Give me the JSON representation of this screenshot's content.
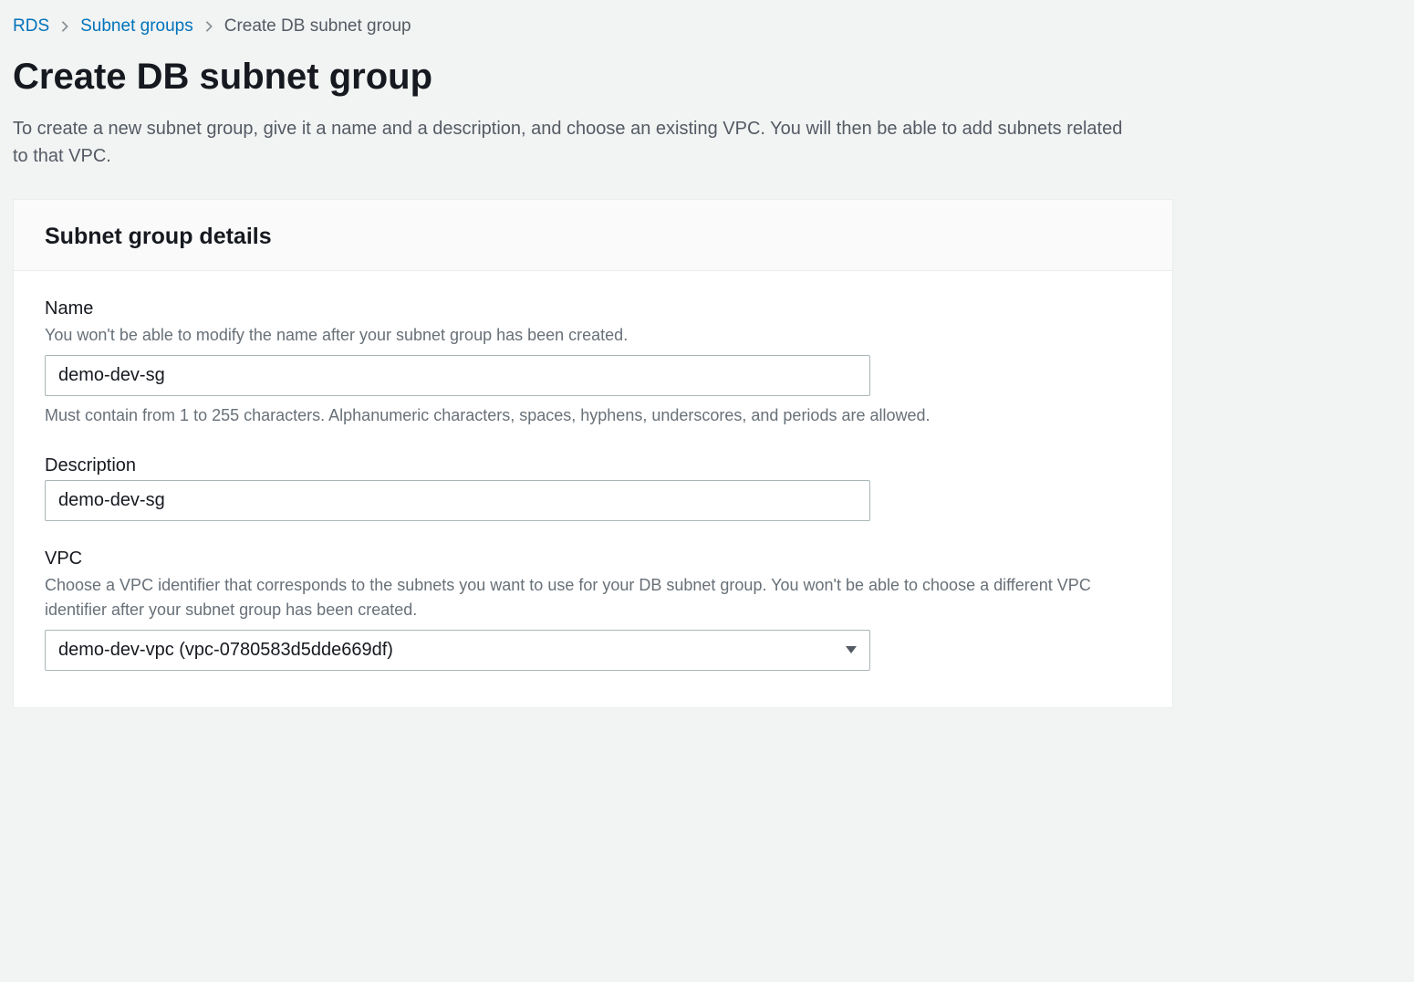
{
  "breadcrumb": {
    "items": [
      {
        "label": "RDS",
        "link": true
      },
      {
        "label": "Subnet groups",
        "link": true
      },
      {
        "label": "Create DB subnet group",
        "link": false
      }
    ]
  },
  "page": {
    "title": "Create DB subnet group",
    "description": "To create a new subnet group, give it a name and a description, and choose an existing VPC. You will then be able to add subnets related to that VPC."
  },
  "panel": {
    "title": "Subnet group details",
    "fields": {
      "name": {
        "label": "Name",
        "hint": "You won't be able to modify the name after your subnet group has been created.",
        "value": "demo-dev-sg",
        "constraint": "Must contain from 1 to 255 characters. Alphanumeric characters, spaces, hyphens, underscores, and periods are allowed."
      },
      "description": {
        "label": "Description",
        "value": "demo-dev-sg"
      },
      "vpc": {
        "label": "VPC",
        "hint": "Choose a VPC identifier that corresponds to the subnets you want to use for your DB subnet group. You won't be able to choose a different VPC identifier after your subnet group has been created.",
        "selected": "demo-dev-vpc (vpc-0780583d5dde669df)"
      }
    }
  }
}
